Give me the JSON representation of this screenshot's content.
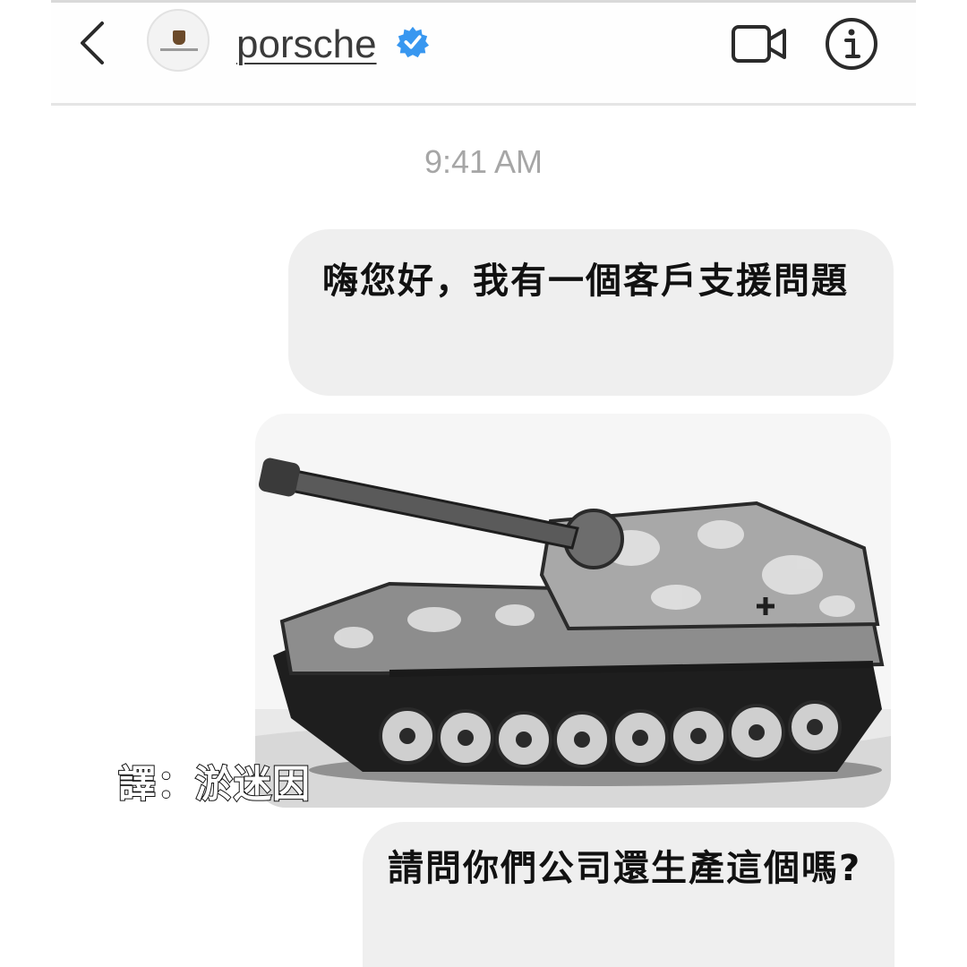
{
  "header": {
    "username": "porsche",
    "avatar_icon": "porsche-logo-icon",
    "verified_icon": "verified-badge-icon",
    "back_icon": "chevron-left-icon",
    "video_icon": "video-camera-icon",
    "info_icon": "info-icon"
  },
  "conversation": {
    "timestamp": "9:41 AM",
    "messages": [
      {
        "type": "text",
        "text": "嗨您好，我有一個客戶支援問題"
      },
      {
        "type": "image",
        "subject": "tank-photo"
      },
      {
        "type": "text",
        "text": "請問你們公司還生產這個嗎?"
      }
    ]
  },
  "watermark": {
    "text": "譯：淤迷因"
  },
  "colors": {
    "bubble": "#efefef",
    "verified": "#3897f0",
    "timestamp": "#a6a6a6"
  }
}
